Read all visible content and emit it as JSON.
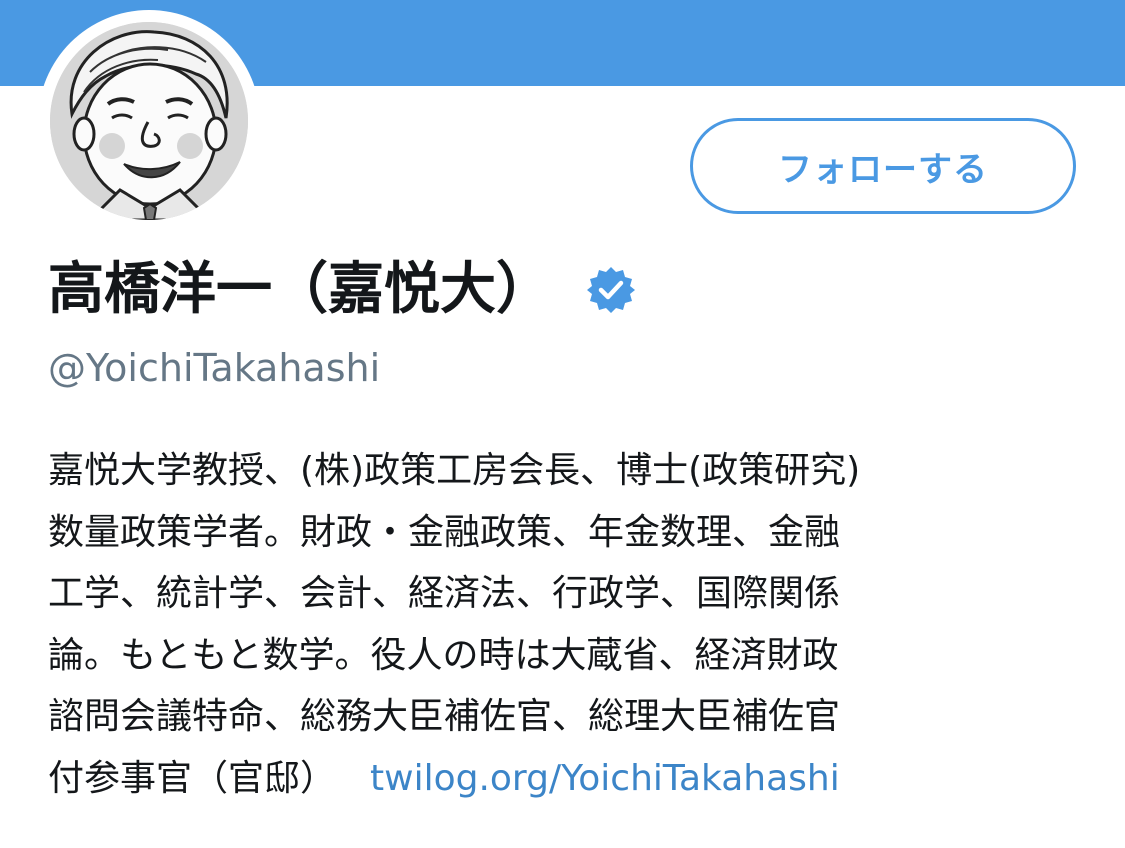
{
  "colors": {
    "banner": "#4a99e3",
    "accent": "#4a99e3",
    "link": "#3c85c8",
    "handle": "#657786",
    "text": "#14171a"
  },
  "profile": {
    "avatar_icon": "caricature-avatar",
    "verified_icon": "verified-badge-icon",
    "display_name": "高橋洋一（嘉悦大）",
    "handle": "@YoichiTakahashi",
    "bio_lines": [
      "嘉悦大学教授、(株)政策工房会長、博士(政策研究)",
      "数量政策学者。財政・金融政策、年金数理、金融",
      "工学、統計学、会計、経済法、行政学、国際関係",
      "論。もともと数学。役人の時は大蔵省、経済財政",
      "諮問会議特命、総務大臣補佐官、総理大臣補佐官",
      "付参事官（官邸）"
    ],
    "bio_link": "twilog.org/YoichiTakahashi"
  },
  "actions": {
    "follow_label": "フォローする"
  }
}
